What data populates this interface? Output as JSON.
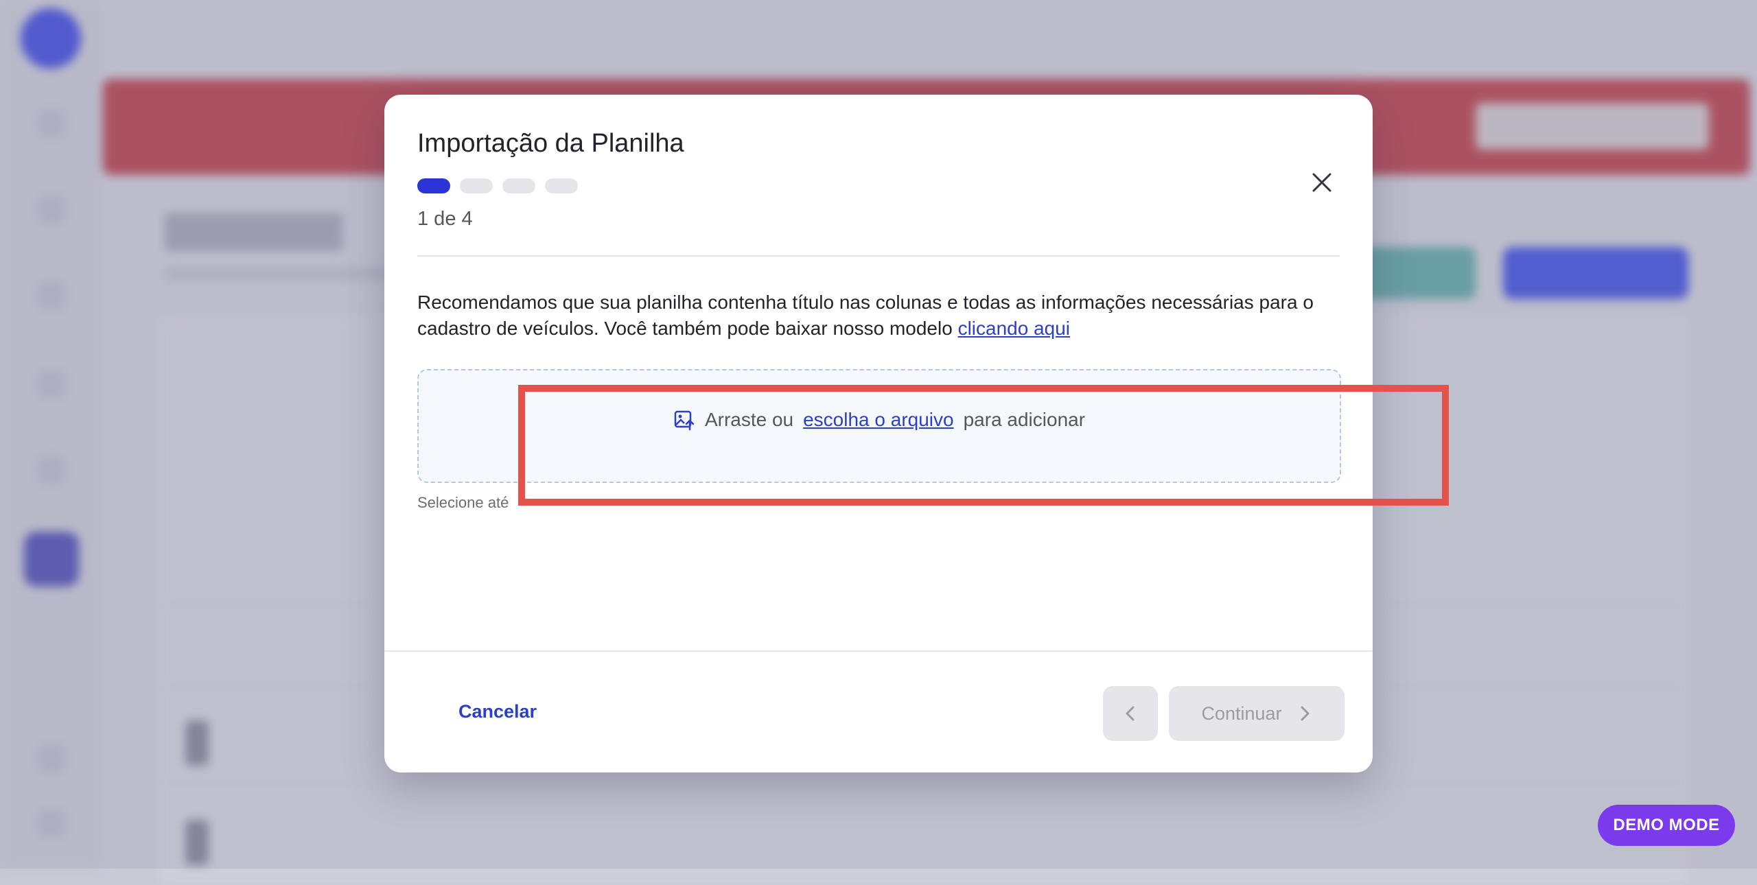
{
  "modal": {
    "title": "Importação da Planilha",
    "step_text": "1 de 4",
    "steps_total": 4,
    "steps_current": 1,
    "description_text": "Recomendamos que sua planilha contenha título nas colunas e todas as informações necessárias para o cadastro de veículos. Você também pode baixar nosso modelo ",
    "description_link": "clicando aqui",
    "dropzone": {
      "icon": "image-upload-icon",
      "text_before": "Arraste ou",
      "link": "escolha o arquivo",
      "text_after": "para adicionar"
    },
    "hint": "Selecione até",
    "cancel_label": "Cancelar",
    "continue_label": "Continuar"
  },
  "demo_badge": "DEMO MODE",
  "colors": {
    "accent": "#2b35d6",
    "link": "#2b3fc9",
    "highlight": "#e5524c",
    "demo": "#7c3aed",
    "banner": "#b23b48"
  }
}
